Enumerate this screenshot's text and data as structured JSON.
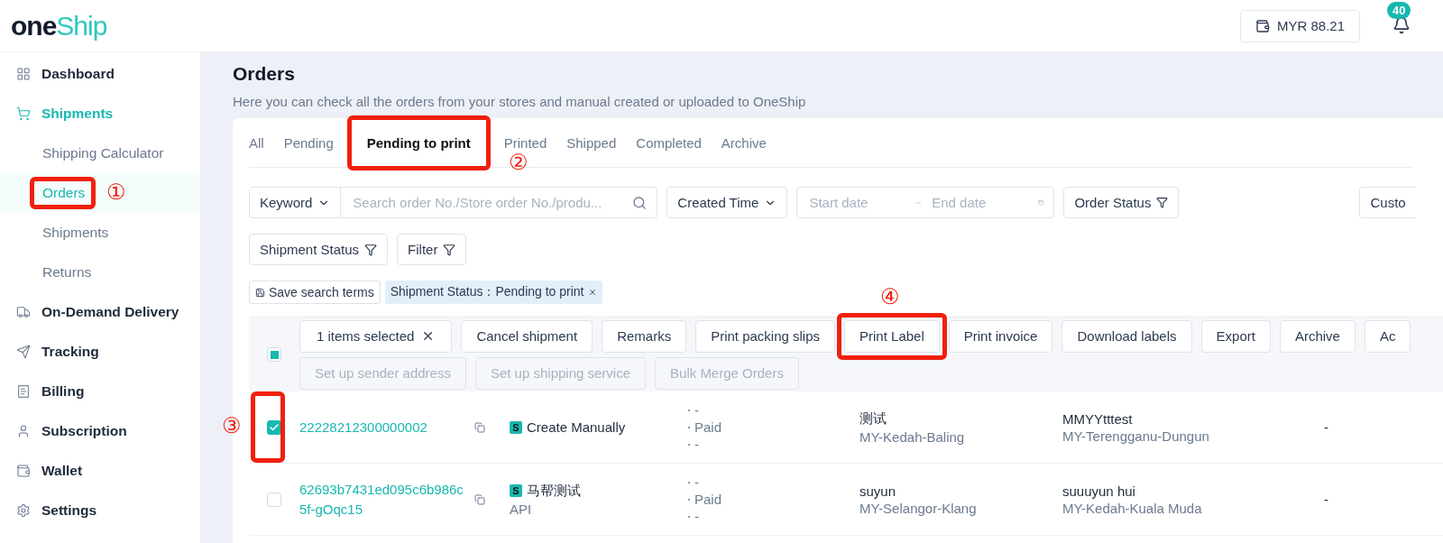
{
  "header": {
    "logo": {
      "part_1": "one",
      "part_2": "Ship"
    },
    "wallet": "MYR 88.21",
    "notifications": "40"
  },
  "sidebar": {
    "items": [
      {
        "label": "Dashboard",
        "kind": "section",
        "selected": false
      },
      {
        "label": "Shipments",
        "kind": "section",
        "selected": true
      },
      {
        "label": "Shipping Calculator",
        "kind": "subitem",
        "selected": false
      },
      {
        "label": "Orders",
        "kind": "subitem",
        "selected": true,
        "annotation": "①"
      },
      {
        "label": "Shipments",
        "kind": "subitem",
        "selected": false
      },
      {
        "label": "Returns",
        "kind": "subitem",
        "selected": false
      },
      {
        "label": "On-Demand Delivery",
        "kind": "section",
        "selected": false
      },
      {
        "label": "Tracking",
        "kind": "section",
        "selected": false
      },
      {
        "label": "Billing",
        "kind": "section",
        "selected": false
      },
      {
        "label": "Subscription",
        "kind": "section",
        "selected": false
      },
      {
        "label": "Wallet",
        "kind": "section",
        "selected": false
      },
      {
        "label": "Settings",
        "kind": "section",
        "selected": false
      }
    ]
  },
  "page": {
    "title": "Orders",
    "subtitle": "Here you can check all the orders from your stores and manual created or uploaded to OneShip"
  },
  "tabs": [
    {
      "label": "All",
      "selected": false
    },
    {
      "label": "Pending",
      "selected": false
    },
    {
      "label": "Pending to print",
      "selected": true,
      "annotation": "②"
    },
    {
      "label": "Printed",
      "selected": false
    },
    {
      "label": "Shipped",
      "selected": false
    },
    {
      "label": "Completed",
      "selected": false
    },
    {
      "label": "Archive",
      "selected": false
    }
  ],
  "filters": {
    "keyword": "Keyword",
    "search_placeholder": "Search order No./Store order No./produ...",
    "time": "Created Time",
    "start_placeholder": "Start date",
    "end_placeholder": "End date",
    "order_status": "Order Status",
    "custom": "Custo",
    "shipment_status": "Shipment Status",
    "filter": "Filter"
  },
  "saved": {
    "save": "Save search terms",
    "tag": "Shipment Status：Pending to print"
  },
  "toolbar": {
    "selection": "1 items selected",
    "select_all_indeterminate": true,
    "actions": [
      {
        "label": "Cancel shipment",
        "disabled": false
      },
      {
        "label": "Remarks",
        "disabled": false
      },
      {
        "label": "Print packing slips",
        "disabled": false
      },
      {
        "label": "Print Label",
        "disabled": false,
        "annotation": "④"
      },
      {
        "label": "Print invoice",
        "disabled": false
      },
      {
        "label": "Download labels",
        "disabled": false
      },
      {
        "label": "Export",
        "disabled": false
      },
      {
        "label": "Archive",
        "disabled": false
      },
      {
        "label": "Ac",
        "disabled": false
      },
      {
        "label": "Set up sender address",
        "disabled": true
      },
      {
        "label": "Set up shipping service",
        "disabled": true
      },
      {
        "label": "Bulk Merge Orders",
        "disabled": true
      }
    ]
  },
  "rows": [
    {
      "checked": true,
      "annotation": "③",
      "order_no": "22228212300000002",
      "store_badge": "S",
      "store": "Create Manually",
      "payment": [
        "-",
        "Paid",
        "-"
      ],
      "sender": "测试",
      "sender_region": "MY-Kedah-Baling",
      "recipient": "MMYYtttest",
      "recipient_region": "MY-Terengganu-Dungun",
      "column_7": "-"
    },
    {
      "checked": false,
      "order_no": "62693b7431ed095c6b986c5f-gOqc15",
      "store_badge": "S",
      "store": "马帮测试",
      "store_source": "API",
      "payment": [
        "-",
        "Paid",
        "-"
      ],
      "sender": "suyun",
      "sender_region": "MY-Selangor-Klang",
      "recipient": "suuuyun hui",
      "recipient_region": "MY-Kedah-Kuala Muda",
      "column_7": "-"
    }
  ]
}
